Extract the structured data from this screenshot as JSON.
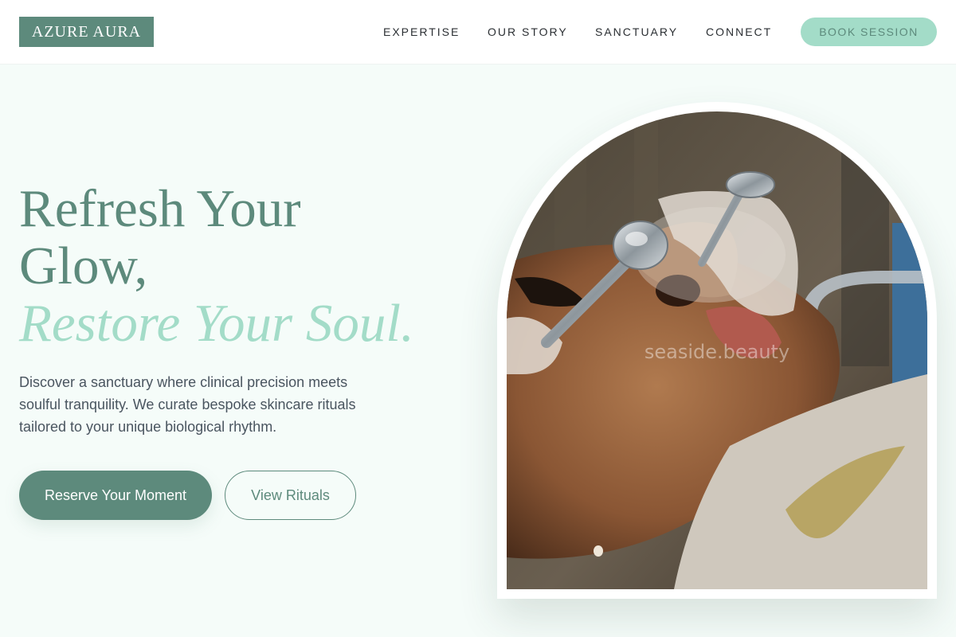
{
  "brand": {
    "name": "AZURE AURA"
  },
  "nav": {
    "links": [
      "EXPERTISE",
      "OUR STORY",
      "SANCTUARY",
      "CONNECT"
    ],
    "cta": "BOOK SESSION"
  },
  "hero": {
    "title_line1": "Refresh Your",
    "title_line2": "Glow,",
    "title_accent": "Restore Your Soul.",
    "description": "Discover a sanctuary where clinical precision meets soulful tranquility. We curate bespoke skincare rituals tailored to your unique biological rhythm.",
    "primary_button": "Reserve Your Moment",
    "secondary_button": "View Rituals"
  },
  "image": {
    "watermark": "seaside.beauty",
    "subject": "facial-treatment-photo"
  },
  "colors": {
    "primary": "#5d8a7c",
    "accent": "#a3dcc8",
    "background": "#f5fcf9",
    "text": "#4a5560"
  }
}
